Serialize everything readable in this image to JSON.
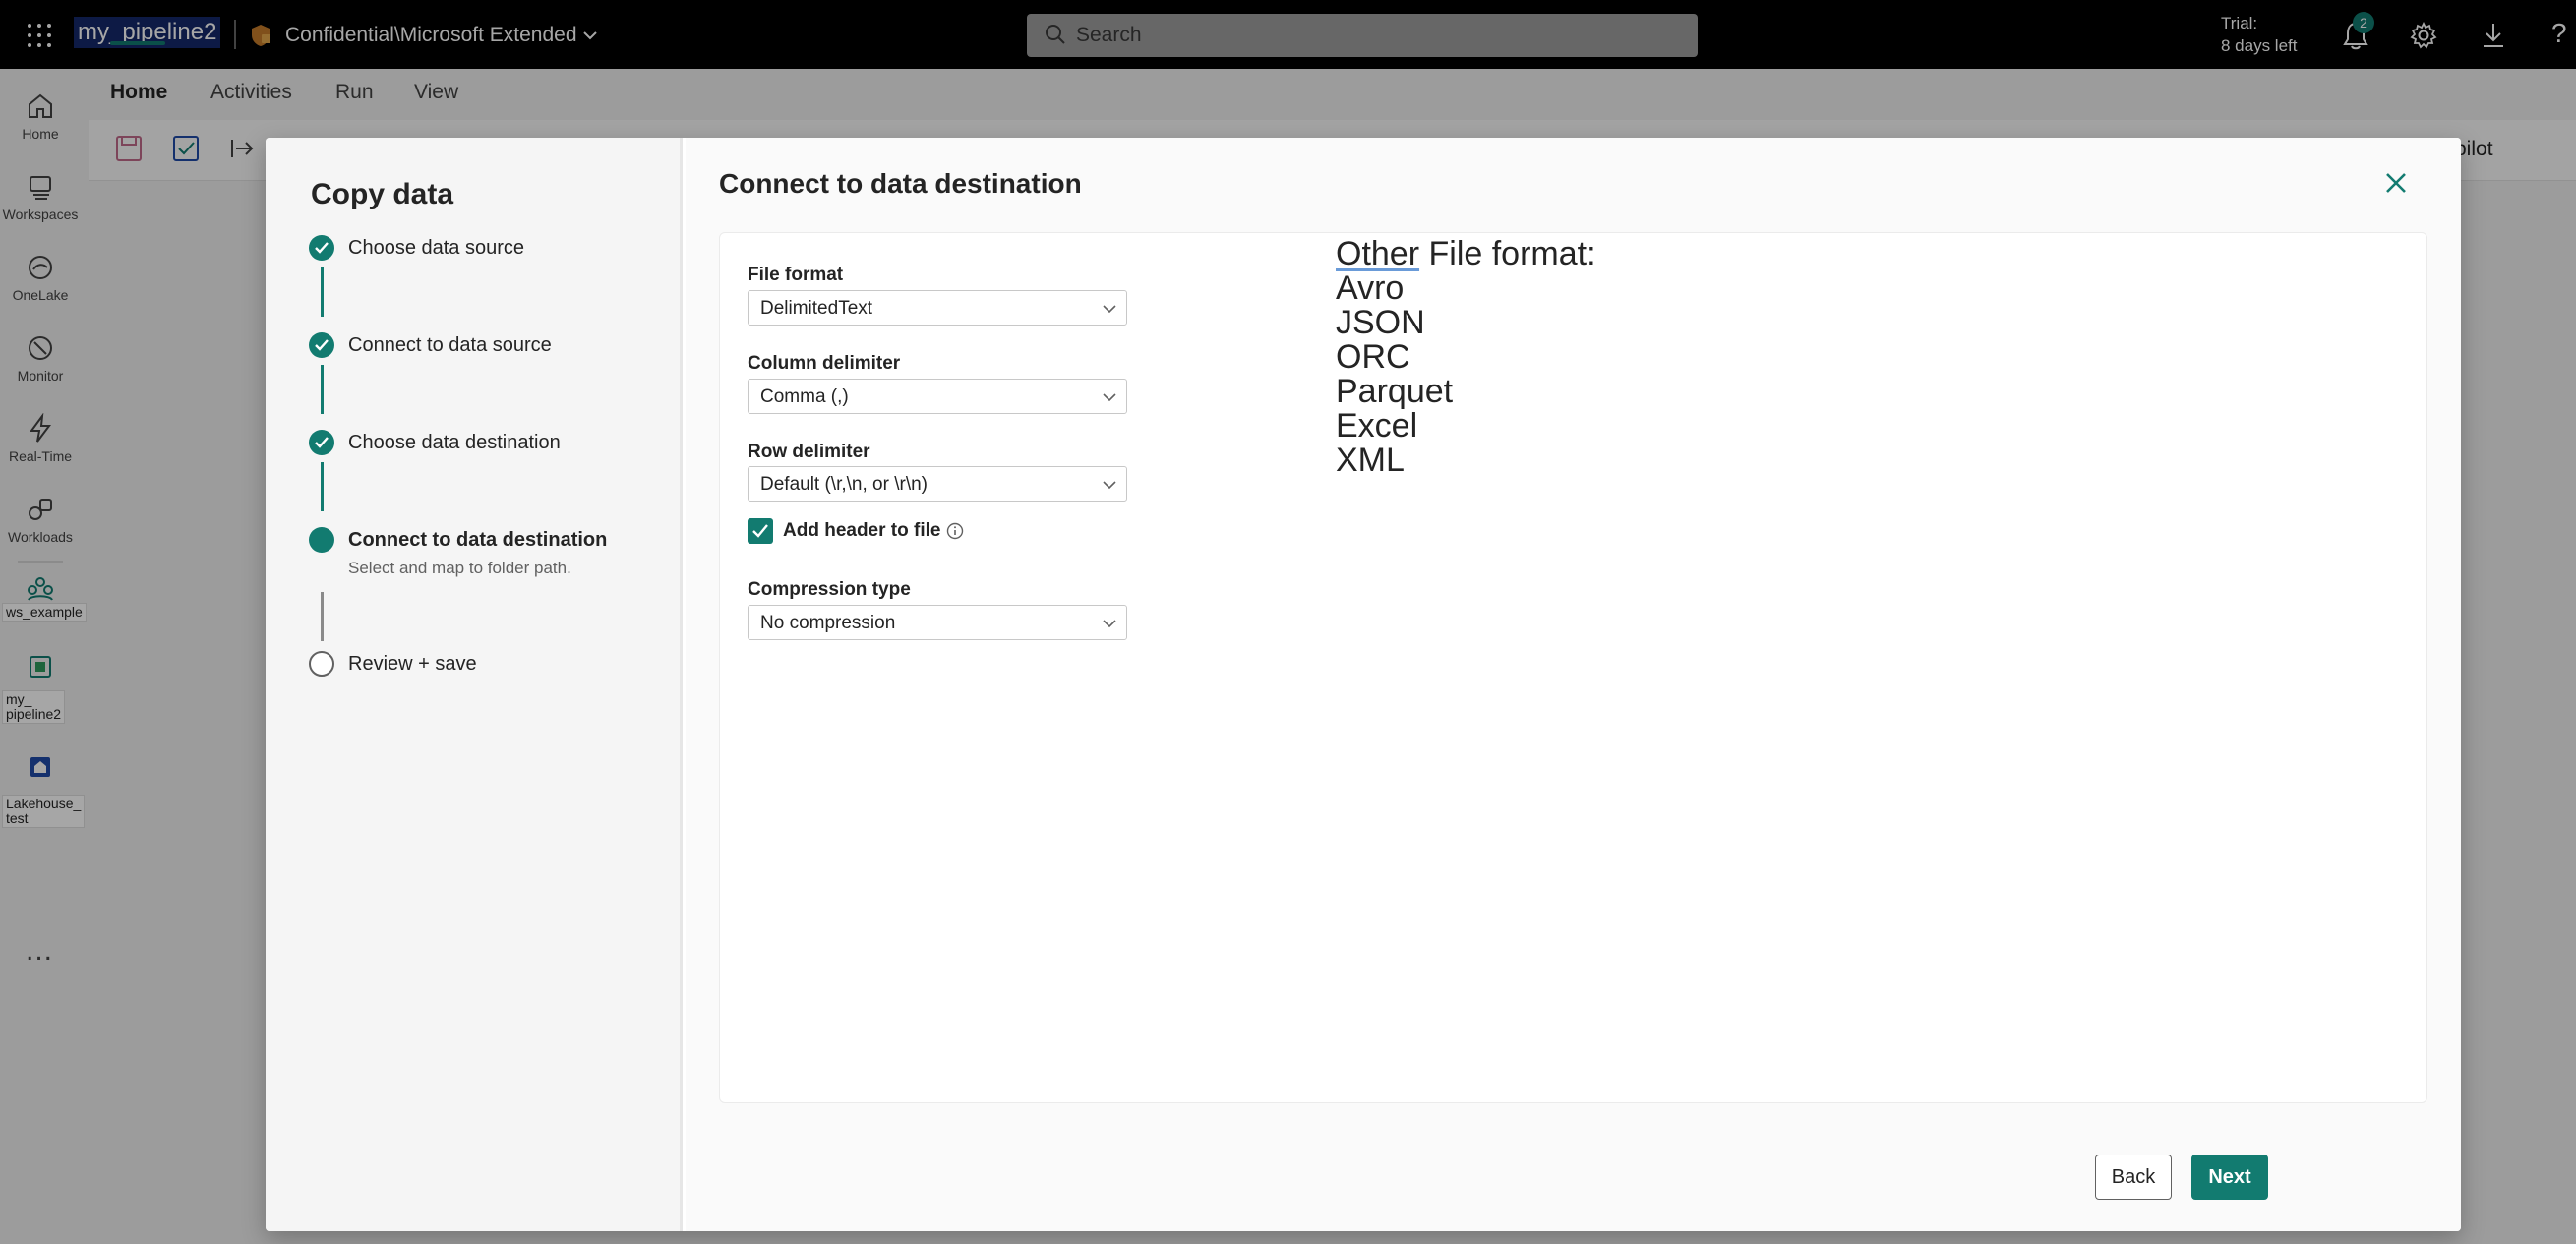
{
  "topbar": {
    "app_name": "my_pipeline2",
    "sensitivity_label": "Confidential\\Microsoft Extended",
    "search_placeholder": "Search",
    "trial_line1": "Trial:",
    "trial_line2": "8 days left",
    "notification_count": "2",
    "help_glyph": "?"
  },
  "rail": {
    "items": [
      {
        "label": "Home",
        "icon": "home-icon"
      },
      {
        "label": "Workspaces",
        "icon": "workspaces-icon"
      },
      {
        "label": "OneLake",
        "icon": "onelake-icon"
      },
      {
        "label": "Monitor",
        "icon": "monitor-icon"
      },
      {
        "label": "Real-Time",
        "icon": "realtime-icon"
      },
      {
        "label": "Workloads",
        "icon": "workloads-icon"
      }
    ],
    "workspace_label": "ws_example",
    "pipeline_label_1": "my_",
    "pipeline_label_2": "pipeline2",
    "lakehouse_label_1": "Lakehouse_",
    "lakehouse_label_2": "test",
    "more_glyph": "..."
  },
  "ribbon": {
    "tabs": [
      "Home",
      "Activities",
      "Run",
      "View"
    ],
    "copilot_label": "pilot"
  },
  "wizard": {
    "title": "Copy data",
    "steps": [
      {
        "label": "Choose data source",
        "status": "done"
      },
      {
        "label": "Connect to data source",
        "status": "done"
      },
      {
        "label": "Choose data destination",
        "status": "done"
      },
      {
        "label": "Connect to data destination",
        "status": "current",
        "sub": "Select and map to folder path."
      },
      {
        "label": "Review + save",
        "status": "todo"
      }
    ]
  },
  "panel": {
    "title": "Connect to data destination",
    "file_format_label": "File format",
    "file_format_value": "DelimitedText",
    "column_delimiter_label": "Column delimiter",
    "column_delimiter_value": "Comma (,)",
    "row_delimiter_label": "Row delimiter",
    "row_delimiter_value": "Default (\\r,\\n, or \\r\\n)",
    "add_header_label": "Add header to file",
    "add_header_checked": true,
    "compression_label": "Compression type",
    "compression_value": "No compression",
    "note_heading_word1": "Other",
    "note_heading_rest": " File format:",
    "note_items": [
      "Avro",
      "JSON",
      "ORC",
      "Parquet",
      "Excel",
      "XML"
    ]
  },
  "buttons": {
    "back": "Back",
    "next": "Next"
  },
  "colors": {
    "accent": "#127b70",
    "topbar": "#000000"
  }
}
